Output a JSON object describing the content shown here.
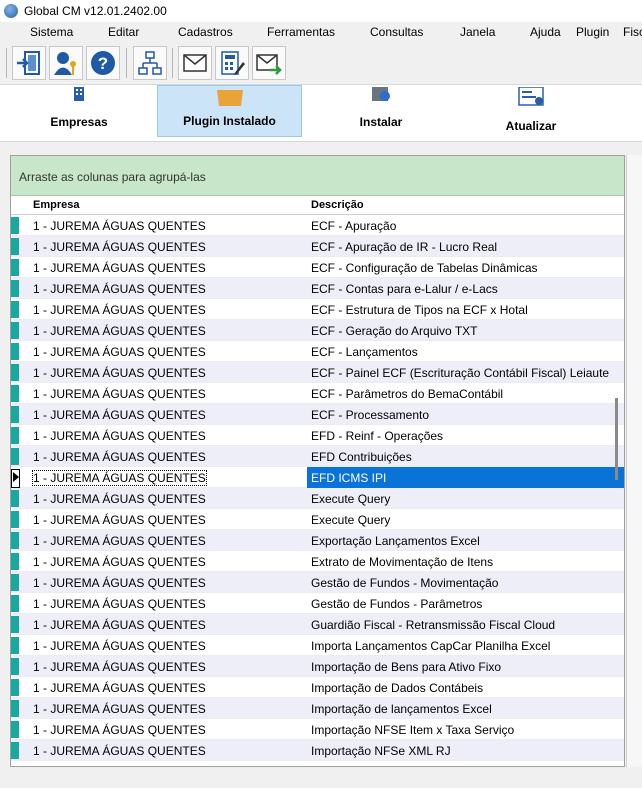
{
  "window": {
    "title": "Global CM v12.01.2402.00"
  },
  "menu": [
    "Sistema",
    "Editar",
    "Cadastros",
    "Ferramentas",
    "Consultas",
    "Janela",
    "Ajuda",
    "Plugin",
    "Fisc"
  ],
  "toolbar_icons": [
    "exit-icon",
    "user-key-icon",
    "help-icon",
    "org-chart-icon",
    "envelope-icon",
    "calculator-edit-icon",
    "send-mail-icon"
  ],
  "ribbon": {
    "empresas": "Empresas",
    "plugin_instalado": "Plugin Instalado",
    "instalar": "Instalar",
    "atualizar": "Atualizar",
    "active": "plugin_instalado"
  },
  "grid": {
    "group_hint": "Arraste as colunas para agrupá-las",
    "columns": [
      "Empresa",
      "Descrição"
    ],
    "selected_row": 12,
    "rows": [
      [
        "1 - JUREMA ÁGUAS QUENTES",
        "ECF - Apuração"
      ],
      [
        "1 - JUREMA ÁGUAS QUENTES",
        "ECF - Apuração de IR - Lucro Real"
      ],
      [
        "1 - JUREMA ÁGUAS QUENTES",
        "ECF - Configuração de Tabelas Dinâmicas"
      ],
      [
        "1 - JUREMA ÁGUAS QUENTES",
        "ECF - Contas para e-Lalur / e-Lacs"
      ],
      [
        "1 - JUREMA ÁGUAS QUENTES",
        "ECF - Estrutura de Tipos na ECF x Hotal"
      ],
      [
        "1 - JUREMA ÁGUAS QUENTES",
        "ECF - Geração do Arquivo TXT"
      ],
      [
        "1 - JUREMA ÁGUAS QUENTES",
        "ECF - Lançamentos"
      ],
      [
        "1 - JUREMA ÁGUAS QUENTES",
        "ECF - Painel ECF (Escrituração Contábil Fiscal) Leiaute"
      ],
      [
        "1 - JUREMA ÁGUAS QUENTES",
        "ECF - Parâmetros do BemaContábil"
      ],
      [
        "1 - JUREMA ÁGUAS QUENTES",
        "ECF - Processamento"
      ],
      [
        "1 - JUREMA ÁGUAS QUENTES",
        "EFD - Reinf - Operações"
      ],
      [
        "1 - JUREMA ÁGUAS QUENTES",
        "EFD Contribuições"
      ],
      [
        "1 - JUREMA ÁGUAS QUENTES",
        "EFD ICMS IPI"
      ],
      [
        "1 - JUREMA ÁGUAS QUENTES",
        "Execute Query"
      ],
      [
        "1 - JUREMA ÁGUAS QUENTES",
        "Execute Query"
      ],
      [
        "1 - JUREMA ÁGUAS QUENTES",
        "Exportação Lançamentos Excel"
      ],
      [
        "1 - JUREMA ÁGUAS QUENTES",
        "Extrato de Movimentação de Itens"
      ],
      [
        "1 - JUREMA ÁGUAS QUENTES",
        "Gestão de Fundos - Movimentação"
      ],
      [
        "1 - JUREMA ÁGUAS QUENTES",
        "Gestão de Fundos - Parâmetros"
      ],
      [
        "1 - JUREMA ÁGUAS QUENTES",
        "Guardião Fiscal - Retransmissão Fiscal Cloud"
      ],
      [
        "1 - JUREMA ÁGUAS QUENTES",
        "Importa Lançamentos CapCar Planilha Excel"
      ],
      [
        "1 - JUREMA ÁGUAS QUENTES",
        "Importação de Bens para Ativo Fixo"
      ],
      [
        "1 - JUREMA ÁGUAS QUENTES",
        "Importação de Dados Contábeis"
      ],
      [
        "1 - JUREMA ÁGUAS QUENTES",
        "Importação de lançamentos Excel"
      ],
      [
        "1 - JUREMA ÁGUAS QUENTES",
        "Importação NFSE Item x Taxa Serviço"
      ],
      [
        "1 - JUREMA ÁGUAS QUENTES",
        "Importação NFSe XML RJ"
      ]
    ]
  }
}
